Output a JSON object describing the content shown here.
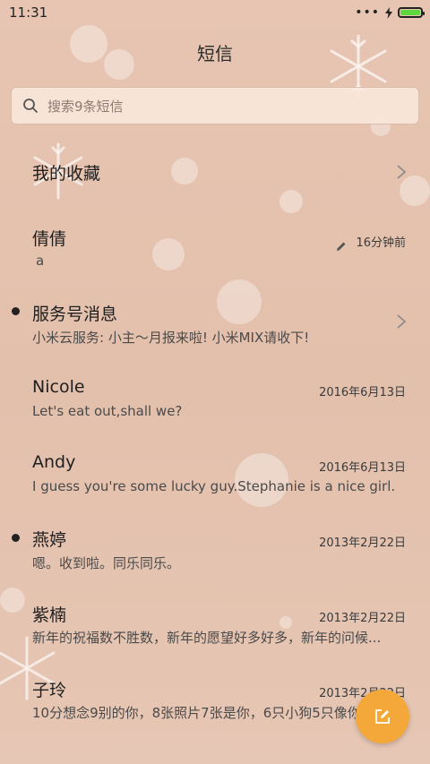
{
  "status": {
    "time": "11:31"
  },
  "header": {
    "title": "短信"
  },
  "search": {
    "placeholder": "搜索9条短信"
  },
  "favorites": {
    "label": "我的收藏"
  },
  "conversations": [
    {
      "name": "倩倩",
      "snippet": "a",
      "time": "16分钟前",
      "draft": true
    },
    {
      "name": "服务号消息",
      "snippet": "小米云服务: 小主～月报来啦! 小米MIX请收下!",
      "unread": true
    },
    {
      "name": "Nicole",
      "snippet": "Let's eat out,shall we?",
      "time": "2016年6月13日"
    },
    {
      "name": "Andy",
      "snippet": "I guess you're some lucky guy.Stephanie is a nice girl.",
      "time": "2016年6月13日"
    },
    {
      "name": "燕婷",
      "snippet": "嗯。收到啦。同乐同乐。",
      "time": "2013年2月22日",
      "unread": true
    },
    {
      "name": "紫楠",
      "snippet": "新年的祝福数不胜数，新年的愿望好多好多，新年的问候...",
      "time": "2013年2月22日"
    },
    {
      "name": "子玲",
      "snippet": "10分想念9别的你，8张照片7张是你，6只小狗5只像你",
      "time": "2013年2月22日"
    }
  ],
  "icons": {
    "search": "search-icon",
    "chevron": "chevron-right-icon",
    "draft": "pencil-icon",
    "compose": "compose-icon"
  },
  "colors": {
    "fab": "#f5a83a",
    "battery": "#5cd83c"
  }
}
